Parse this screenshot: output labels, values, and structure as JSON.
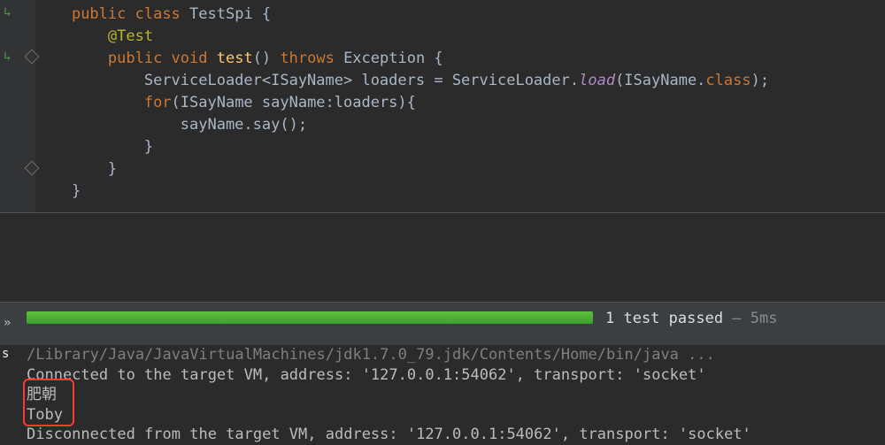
{
  "code": {
    "lines": [
      {
        "indent": 1,
        "tokens": [
          {
            "t": "public ",
            "c": "kw"
          },
          {
            "t": "class ",
            "c": "kw"
          },
          {
            "t": "TestSpi ",
            "c": "id"
          },
          {
            "t": "{",
            "c": "punc"
          }
        ]
      },
      {
        "indent": 2,
        "tokens": [
          {
            "t": "@Test",
            "c": "ann"
          }
        ]
      },
      {
        "indent": 2,
        "tokens": [
          {
            "t": "public ",
            "c": "kw"
          },
          {
            "t": "void ",
            "c": "kw"
          },
          {
            "t": "test",
            "c": "fn"
          },
          {
            "t": "() ",
            "c": "punc"
          },
          {
            "t": "throws ",
            "c": "kw"
          },
          {
            "t": "Exception {",
            "c": "id"
          }
        ]
      },
      {
        "indent": 3,
        "tokens": [
          {
            "t": "ServiceLoader<ISayName> loaders = ServiceLoader.",
            "c": "id"
          },
          {
            "t": "load",
            "c": "si"
          },
          {
            "t": "(ISayName.",
            "c": "id"
          },
          {
            "t": "class",
            "c": "kw"
          },
          {
            "t": ");",
            "c": "punc"
          }
        ]
      },
      {
        "indent": 3,
        "tokens": [
          {
            "t": "for",
            "c": "kw"
          },
          {
            "t": "(ISayName sayName:loaders){",
            "c": "id"
          }
        ]
      },
      {
        "indent": 4,
        "tokens": [
          {
            "t": "sayName.say();",
            "c": "id"
          }
        ]
      },
      {
        "indent": 3,
        "tokens": [
          {
            "t": "}",
            "c": "punc"
          }
        ]
      },
      {
        "indent": 2,
        "tokens": [
          {
            "t": "}",
            "c": "punc"
          }
        ]
      },
      {
        "indent": 1,
        "tokens": [
          {
            "t": "}",
            "c": "punc"
          }
        ]
      }
    ]
  },
  "testResults": {
    "passed_label": "1 test passed",
    "time_label": " – 5ms",
    "progress_pct": 100
  },
  "console": {
    "jdk_line": "/Library/Java/JavaVirtualMachines/jdk1.7.0_79.jdk/Contents/Home/bin/java ...",
    "connected_line": "Connected to the target VM, address: '127.0.0.1:54062', transport: 'socket'",
    "out1": "肥朝",
    "out2": "Toby",
    "disconnected_line": "Disconnected from the target VM, address: '127.0.0.1:54062', transport: 'socket'"
  },
  "icons": {
    "run_tab_suffix": "s"
  }
}
